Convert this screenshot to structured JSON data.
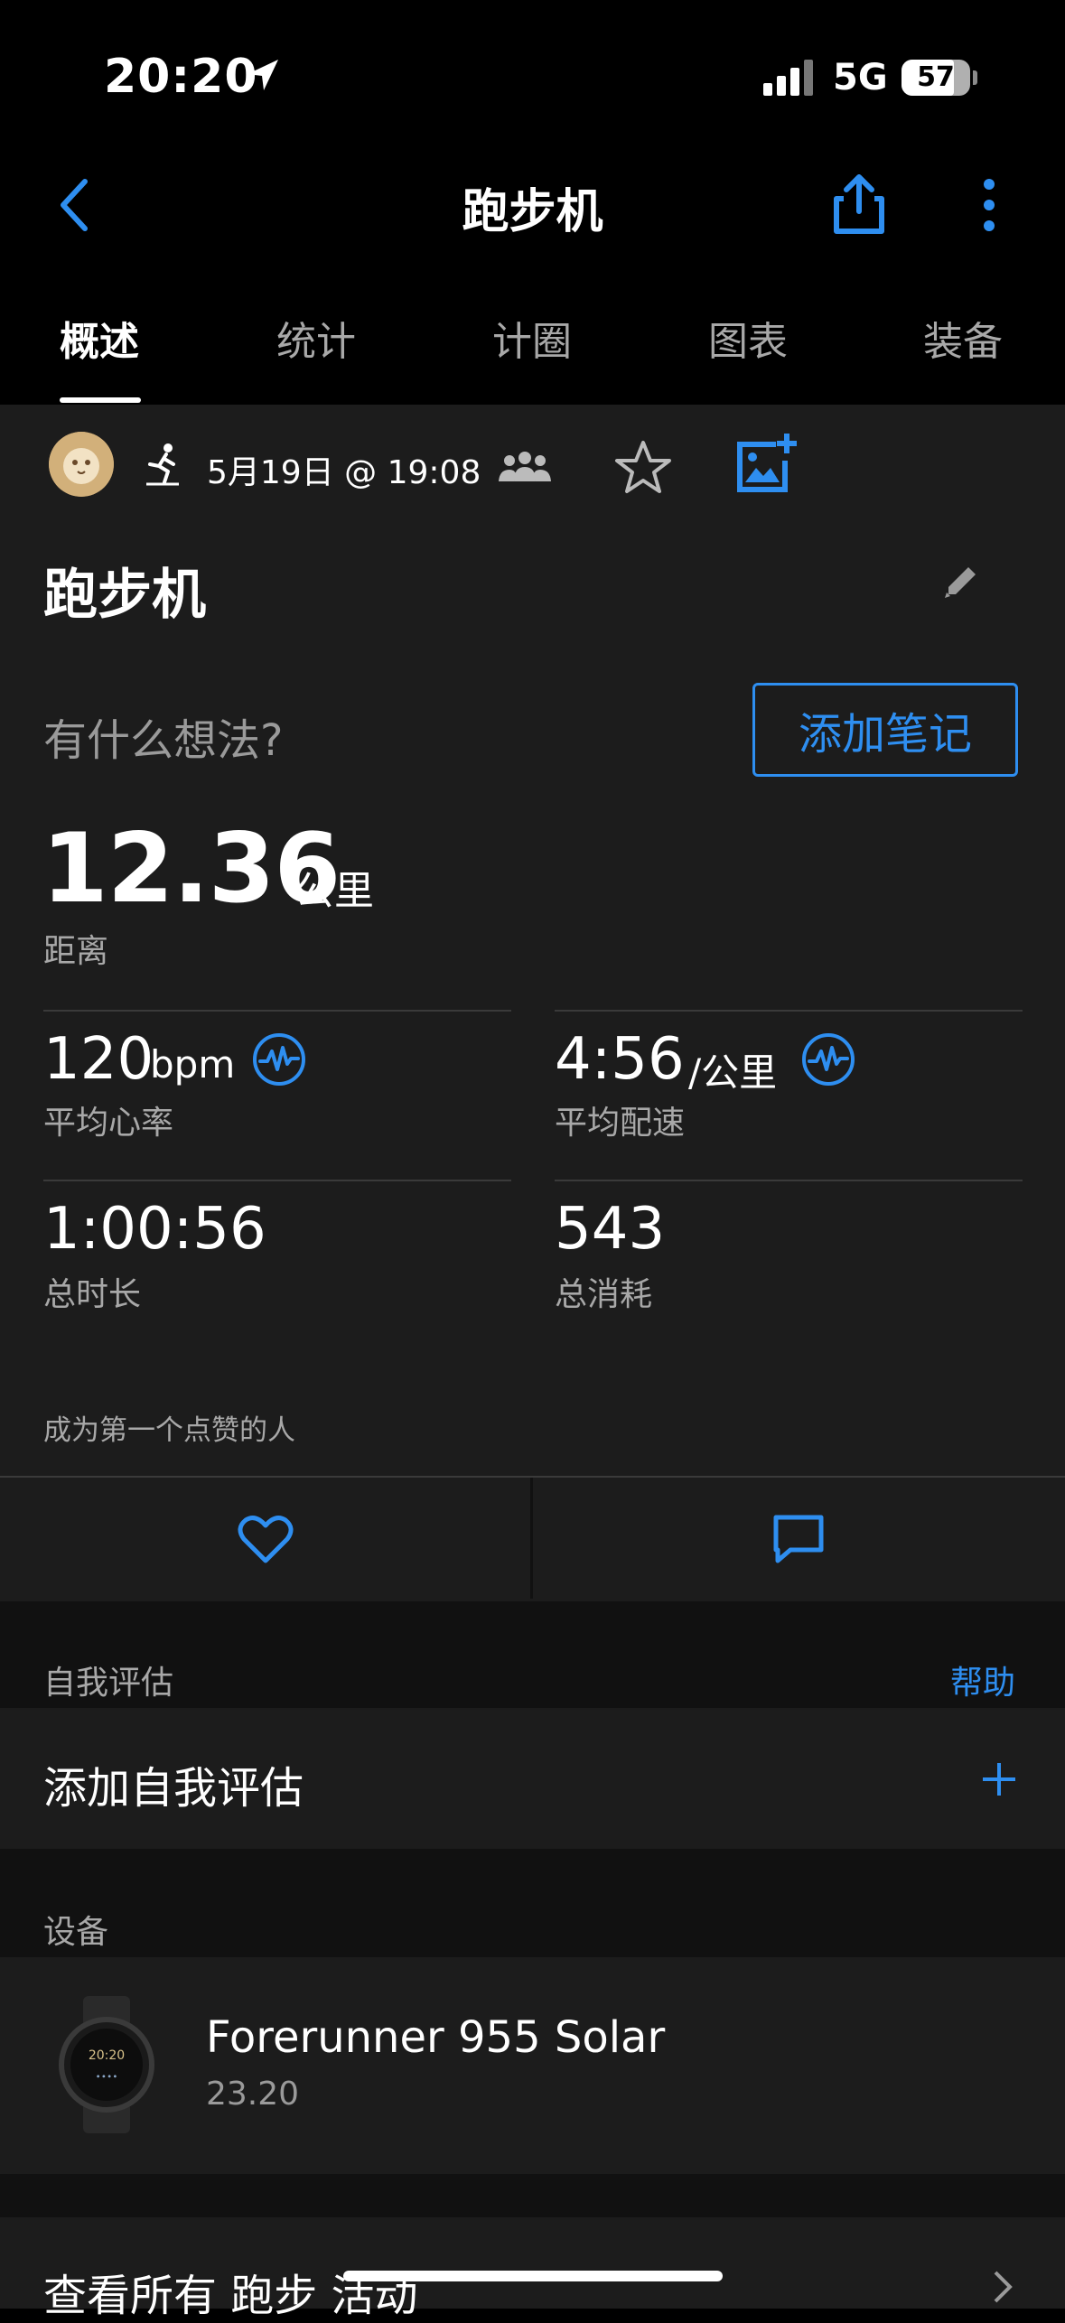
{
  "status_bar": {
    "time": "20:20",
    "network": "5G",
    "battery": "57"
  },
  "nav": {
    "title": "跑步机"
  },
  "tabs": [
    "概述",
    "统计",
    "计圈",
    "图表",
    "装备"
  ],
  "activity": {
    "date": "5月19日 @ 19:08",
    "name": "跑步机",
    "thoughts_placeholder": "有什么想法?",
    "add_note_label": "添加笔记"
  },
  "stats": {
    "distance": {
      "value": "12.36",
      "unit": "公里",
      "label": "距离"
    },
    "heart_rate": {
      "value": "120",
      "unit": "bpm",
      "label": "平均心率"
    },
    "pace": {
      "value": "4:56",
      "unit": "/公里",
      "label": "平均配速"
    },
    "duration": {
      "value": "1:00:56",
      "label": "总时长"
    },
    "calories": {
      "value": "543",
      "label": "总消耗"
    }
  },
  "social": {
    "first_like": "成为第一个点赞的人"
  },
  "self_eval": {
    "header": "自我评估",
    "help": "帮助",
    "add": "添加自我评估"
  },
  "device": {
    "header": "设备",
    "name": "Forerunner 955 Solar",
    "version": "23.20"
  },
  "view_all": "查看所有 跑步 活动",
  "colors": {
    "accent": "#2e8ef0",
    "card": "#1c1c1c",
    "background": "#000000"
  }
}
